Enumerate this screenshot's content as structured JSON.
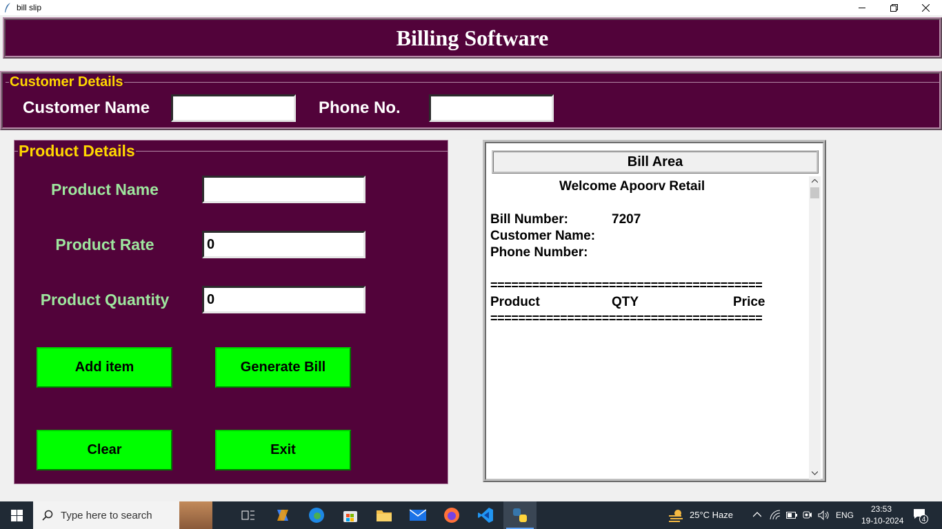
{
  "window": {
    "title": "bill slip",
    "controls": [
      "minimize",
      "restore",
      "close"
    ]
  },
  "heading": {
    "text": "Billing Software"
  },
  "customer": {
    "frame_title": "Customer Details",
    "name_label": "Customer Name",
    "name_value": "",
    "phone_label": "Phone No.",
    "phone_value": ""
  },
  "product": {
    "frame_title": "Product Details",
    "name_label": "Product Name",
    "name_value": "",
    "rate_label": "Product Rate",
    "rate_value": "0",
    "qty_label": "Product Quantity",
    "qty_value": "0",
    "buttons": {
      "add": "Add item",
      "generate": "Generate Bill",
      "clear": "Clear",
      "exit": "Exit"
    }
  },
  "bill": {
    "title": "Bill Area",
    "welcome": "Welcome Apoorv Retail",
    "bill_number_label": "Bill Number:",
    "bill_number": "7207",
    "customer_name_label": "Customer Name:",
    "phone_number_label": "Phone Number:",
    "separator": "=======================================",
    "col_product": "Product",
    "col_qty": "QTY",
    "col_price": "Price"
  },
  "taskbar": {
    "search_placeholder": "Type here to search",
    "weather": "25°C  Haze",
    "language": "ENG",
    "time": "23:53",
    "date": "19-10-2024",
    "notification_count": "4"
  },
  "colors": {
    "frame_bg": "#52033a",
    "frame_title": "#ffd700",
    "product_label": "#9ee69e",
    "button_bg": "#00ff00"
  }
}
